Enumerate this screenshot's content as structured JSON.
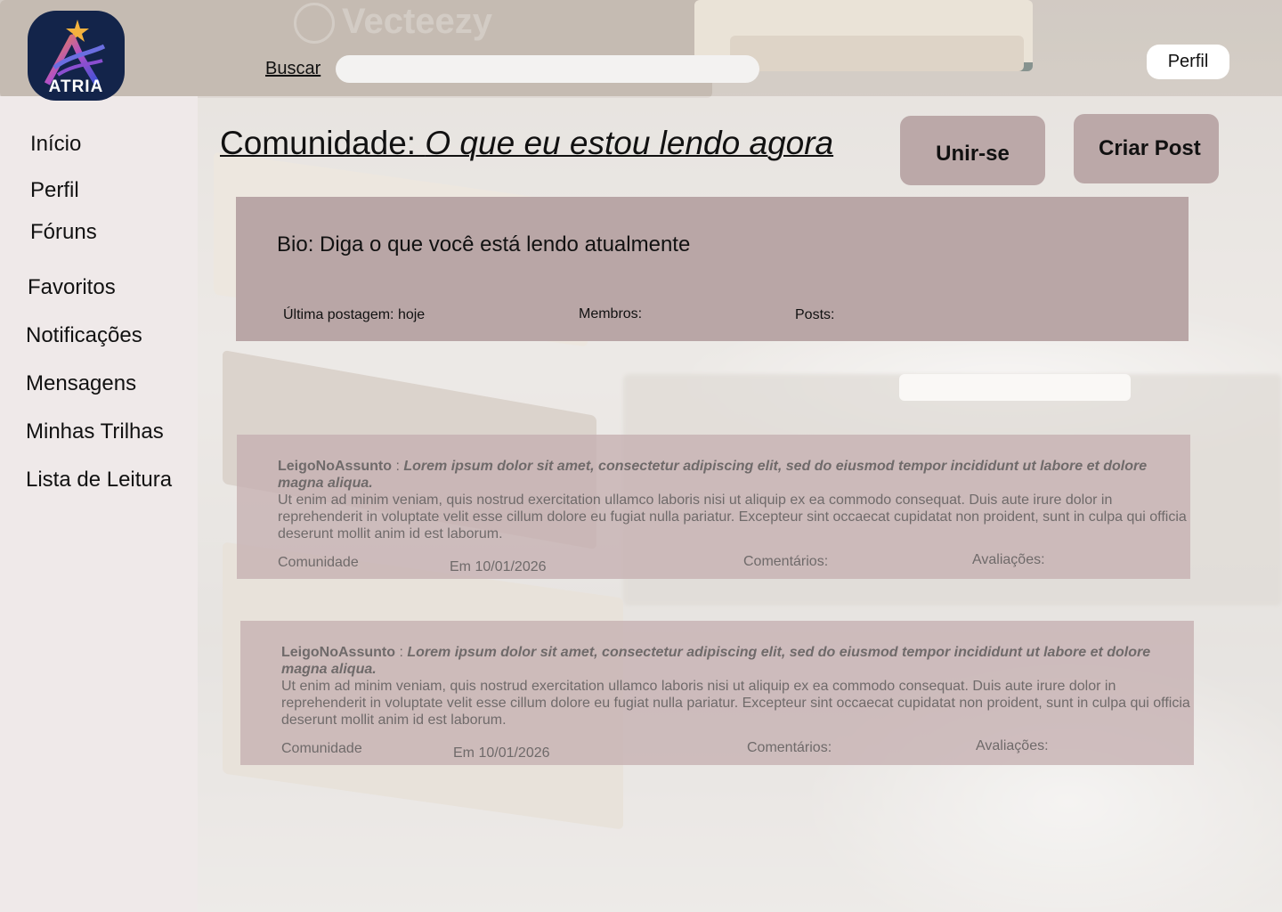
{
  "brand": {
    "name": "ATRIA",
    "watermark": "Vecteezy"
  },
  "topbar": {
    "search_label": "Buscar",
    "search_placeholder": "",
    "profile_label": "Perfil"
  },
  "sidebar": {
    "items": [
      {
        "label": "Início"
      },
      {
        "label": "Perfil"
      },
      {
        "label": "Fóruns"
      },
      {
        "label": "Favoritos"
      },
      {
        "label": "Notificações"
      },
      {
        "label": "Mensagens"
      },
      {
        "label": "Minhas Trilhas"
      },
      {
        "label": "Lista de Leitura"
      }
    ]
  },
  "header": {
    "title_prefix": "Comunidade: ",
    "title_name": "O que eu estou lendo agora",
    "join_label": "Unir-se",
    "create_label": "Criar Post"
  },
  "community": {
    "bio": "Bio: Diga o que você está lendo atualmente",
    "last_post": "Última postagem: hoje",
    "members": "Membros:",
    "posts": "Posts:"
  },
  "posts": [
    {
      "author": "LeigoNoAssunto",
      "separator": " : ",
      "lead": "Lorem ipsum dolor sit amet, consectetur adipiscing elit, sed do eiusmod tempor incididunt ut labore et dolore magna aliqua.",
      "body": "Ut enim ad minim veniam, quis nostrud exercitation ullamco laboris nisi ut aliquip ex ea commodo consequat.  Duis aute irure dolor in reprehenderit in voluptate velit esse cillum dolore eu fugiat nulla pariatur.  Excepteur sint occaecat cupidatat non proident, sunt in culpa qui officia deserunt mollit anim id est laborum.",
      "community": "Comunidade",
      "date": "Em 10/01/2026",
      "comments": "Comentários:",
      "ratings": "Avaliações:"
    },
    {
      "author": "LeigoNoAssunto",
      "separator": " : ",
      "lead": "Lorem ipsum dolor sit amet, consectetur adipiscing elit, sed do eiusmod tempor incididunt ut labore et dolore magna aliqua.",
      "body": "Ut enim ad minim veniam, quis nostrud exercitation ullamco laboris nisi ut aliquip ex ea commodo consequat.  Duis aute irure dolor in reprehenderit in voluptate velit esse cillum dolore eu fugiat nulla pariatur.  Excepteur sint occaecat cupidatat non proident, sunt in culpa qui officia deserunt mollit anim id est laborum.",
      "community": "Comunidade",
      "date": "Em 10/01/2026",
      "comments": "Comentários:",
      "ratings": "Avaliações:"
    }
  ],
  "colors": {
    "sidebar_bg": "#efe9e9",
    "card_bg": "#b9a6a6",
    "button_bg": "#bba8a8",
    "logo_bg": "#13244a"
  }
}
